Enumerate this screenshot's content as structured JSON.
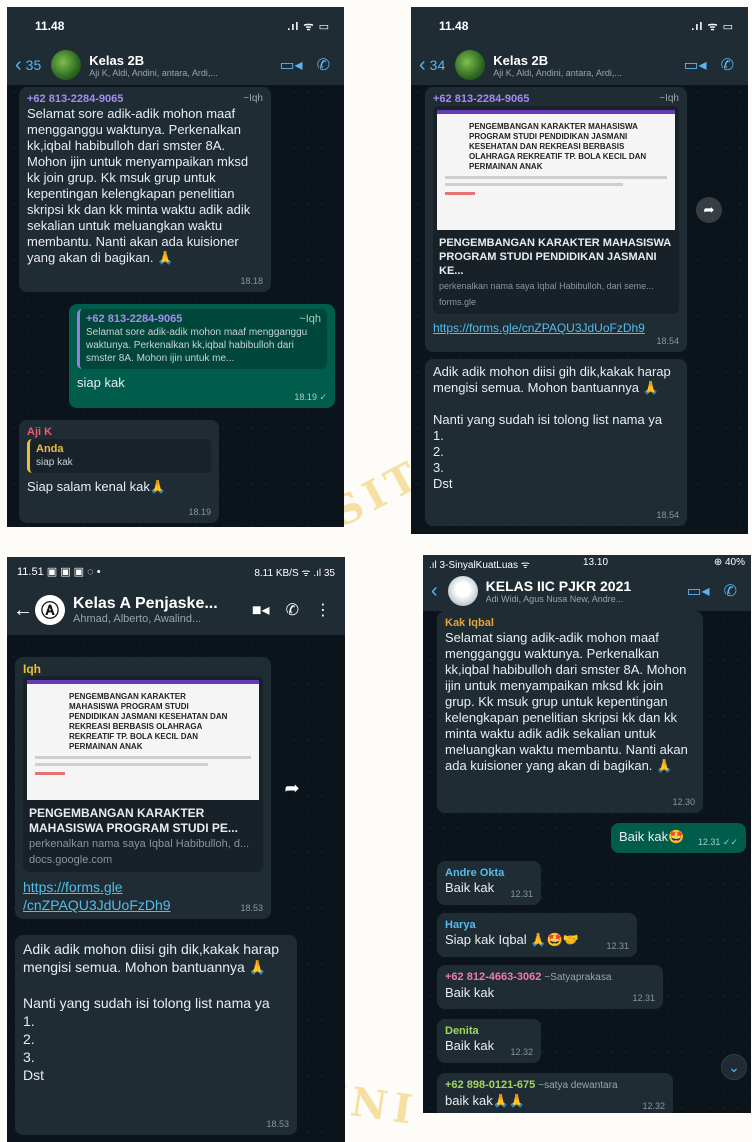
{
  "panel1": {
    "status_time": "11.48",
    "back_count": "35",
    "title": "Kelas 2B",
    "subtitle": "Aji K, Aldi, Andini, antara, Ardi,...",
    "messages": [
      {
        "sender": "+62 813-2284-9065",
        "alias": "~Iqh",
        "text": "Selamat sore adik-adik mohon maaf mengganggu waktunya. Perkenalkan kk,iqbal habibulloh dari smster 8A. Mohon ijin untuk menyampaikan mksd kk join grup. Kk msuk grup untuk kepentingan kelengkapan penelitian skripsi kk dan kk minta waktu adik adik sekalian untuk meluangkan waktu membantu. Nanti akan ada kuisioner yang akan di bagikan. 🙏",
        "time": "18.18"
      },
      {
        "quote_name": "+62 813-2284-9065",
        "quote_alias": "~Iqh",
        "quote_text": "Selamat sore adik-adik mohon maaf mengganggu waktunya. Perkenalkan kk,iqbal habibulloh dari smster 8A. Mohon ijin untuk me...",
        "text": "siap kak",
        "time": "18.19 ✓"
      },
      {
        "sender": "Aji K",
        "quote_name": "Anda",
        "quote_text": "siap kak",
        "text": "Siap salam kenal kak🙏",
        "time": "18.19"
      }
    ]
  },
  "panel2": {
    "status_time": "11.48",
    "back_count": "34",
    "title": "Kelas 2B",
    "subtitle": "Aji K, Aldi, Andini, antara, Ardi,...",
    "messages": [
      {
        "sender": "+62 813-2284-9065",
        "alias": "~Iqh",
        "doc_title": "PENGEMBANGAN KARAKTER MAHASISWA PROGRAM STUDI PENDIDIKAN JASMANI KESEHATAN DAN REKREASI BERBASIS OLAHRAGA REKREATIF TP. BOLA KECIL DAN PERMAINAN ANAK",
        "lp_title": "PENGEMBANGAN KARAKTER MAHASISWA PROGRAM STUDI PENDIDIKAN JASMANI KE...",
        "lp_desc": "perkenalkan nama saya Iqbal Habibulloh, dari seme...",
        "lp_domain": "forms.gle",
        "link": "https://forms.gle/cnZPAQU3JdUoFzDh9",
        "time": "18.54"
      },
      {
        "text": "Adik adik mohon diisi gih dik,kakak harap mengisi semua. Mohon bantuannya 🙏\n\nNanti yang sudah isi tolong list nama ya\n1.\n2.\n3.\nDst",
        "time": "18.54"
      }
    ]
  },
  "panel3": {
    "status_time": "11.51",
    "status_icons": "8.11 KB/S ᯤ .ıl 35",
    "title": "Kelas A Penjaske...",
    "subtitle": "Ahmad, Alberto, Awalind...",
    "messages": [
      {
        "sender": "Iqh",
        "doc_title": "PENGEMBANGAN KARAKTER MAHASISWA PROGRAM STUDI PENDIDIKAN JASMANI KESEHATAN DAN REKREASI BERBASIS OLAHRAGA REKREATIF TP. BOLA KECIL DAN PERMAINAN ANAK",
        "lp_title": "PENGEMBANGAN KARAKTER MAHASISWA PROGRAM STUDI PE...",
        "lp_desc": "perkenalkan nama saya Iqbal Habibulloh, d...",
        "lp_domain": "docs.google.com",
        "link": "https://forms.gle\n/cnZPAQU3JdUoFzDh9",
        "time": "18.53"
      },
      {
        "text": "Adik adik mohon diisi gih dik,kakak harap mengisi semua. Mohon bantuannya 🙏\n\nNanti yang sudah isi tolong list nama ya\n1.\n2.\n3.\nDst",
        "time": "18.53"
      }
    ]
  },
  "panel4": {
    "status_left": ".ıl 3-SinyalKuatLuas ᯤ",
    "status_time": "13.10",
    "status_right": "⊕ 40%",
    "title": "KELAS IIC PJKR 2021",
    "subtitle": "Adi Widi, Agus Nusa New, Andre...",
    "messages": [
      {
        "sender": "Kak Iqbal",
        "text": "Selamat siang adik-adik mohon maaf mengganggu waktunya. Perkenalkan kk,iqbal habibulloh dari smster 8A. Mohon ijin untuk menyampaikan mksd kk join grup. Kk msuk grup untuk kepentingan kelengkapan penelitian skripsi kk dan kk minta waktu adik adik sekalian untuk meluangkan waktu membantu. Nanti akan ada kuisioner yang akan di bagikan. 🙏",
        "time": "12.30"
      },
      {
        "text": "Baik kak🤩",
        "time": "12.31 ✓✓"
      },
      {
        "sender": "Andre Okta",
        "text": "Baik kak",
        "time": "12.31"
      },
      {
        "sender": "Harya",
        "text": "Siap kak Iqbal 🙏🤩🤝",
        "time": "12.31"
      },
      {
        "sender": "+62 812-4663-3062",
        "alias": "~Satyaprakasa",
        "text": "Baik kak",
        "time": "12.31"
      },
      {
        "sender": "Denita",
        "text": "Baik kak",
        "time": "12.32"
      },
      {
        "sender": "+62 898-0121-675",
        "alias": "~satya dewantara",
        "text": "baik kak🙏🙏",
        "time": "12.32"
      }
    ]
  },
  "colors": {
    "chat_bg": "#0b141a",
    "incoming": "#1f2c34",
    "outgoing": "#005c4b",
    "ios_blue": "#5ab3f5",
    "link": "#53bdeb"
  }
}
